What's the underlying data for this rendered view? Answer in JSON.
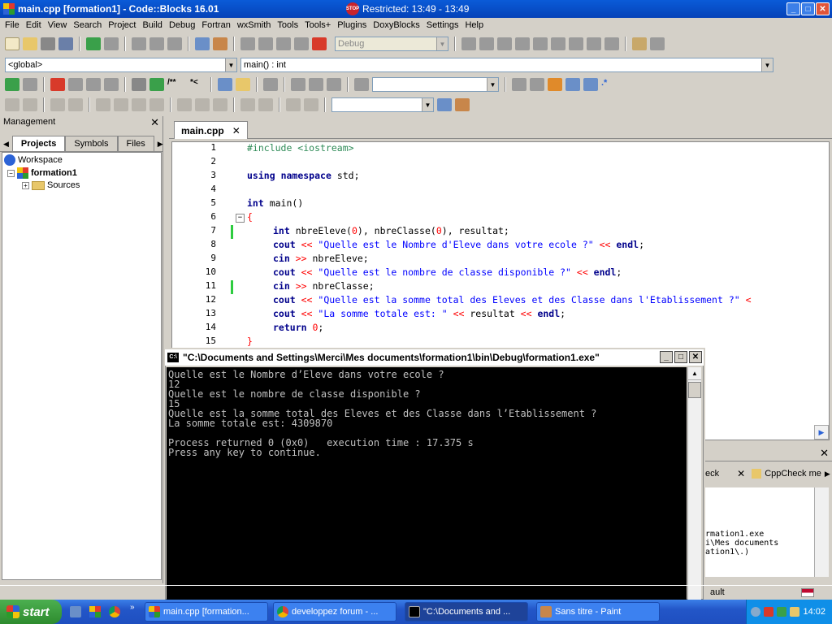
{
  "window": {
    "title": "main.cpp [formation1] - Code::Blocks 16.01",
    "restricted": "Restricted: 13:49 - 13:49",
    "stop_label": "STOP"
  },
  "menu": [
    "File",
    "Edit",
    "View",
    "Search",
    "Project",
    "Build",
    "Debug",
    "Fortran",
    "wxSmith",
    "Tools",
    "Tools+",
    "Plugins",
    "DoxyBlocks",
    "Settings",
    "Help"
  ],
  "toolbar": {
    "build_target": "Debug"
  },
  "scope": {
    "global": "<global>",
    "symbol": "main() : int"
  },
  "management": {
    "title": "Management",
    "tabs": [
      "Projects",
      "Symbols",
      "Files"
    ],
    "tree": {
      "workspace": "Workspace",
      "project": "formation1",
      "folder": "Sources"
    }
  },
  "editor": {
    "tab": "main.cpp",
    "lines": [
      "1",
      "2",
      "3",
      "4",
      "5",
      "6",
      "7",
      "8",
      "9",
      "10",
      "11",
      "12",
      "13",
      "14",
      "15"
    ]
  },
  "code": {
    "l1": "#include <iostream>",
    "l3_kw1": "using",
    "l3_kw2": "namespace",
    "l3_rest": "std;",
    "l5_kw": "int",
    "l5_rest": " main()",
    "l6": "{",
    "l7_kw": "int",
    "l7_a": " nbreEleve(",
    "l7_n1": "0",
    "l7_b": "), nbreClasse(",
    "l7_n2": "0",
    "l7_c": "), resultat;",
    "l8_kw": "cout",
    "l8_op": " << ",
    "l8_str": "\"Quelle est le Nombre d'Eleve dans votre ecole ?\"",
    "l8_op2": " << ",
    "l8_end": "endl",
    "l8_semi": ";",
    "l9_kw": "cin",
    "l9_op": " >> ",
    "l9_rest": "nbreEleve;",
    "l10_kw": "cout",
    "l10_op": " << ",
    "l10_str": "\"Quelle est le nombre de classe disponible ?\"",
    "l10_op2": " << ",
    "l10_end": "endl",
    "l10_semi": ";",
    "l11_kw": "cin",
    "l11_op": " >> ",
    "l11_rest": "nbreClasse;",
    "l12_kw": "cout",
    "l12_op": " << ",
    "l12_str": "\"Quelle est la somme total des Eleves et des Classe dans l'Etablissement ?\"",
    "l12_op2": " <",
    "l13_kw": "cout",
    "l13_op": " << ",
    "l13_str": "\"La somme totale est: \"",
    "l13_op2": " << ",
    "l13_mid": "resultat",
    "l13_op3": " << ",
    "l13_end": "endl",
    "l13_semi": ";",
    "l14_kw": "return",
    "l14_n": " 0",
    "l14_semi": ";",
    "l15": "}"
  },
  "console": {
    "title": "\"C:\\Documents and Settings\\Merci\\Mes documents\\formation1\\bin\\Debug\\formation1.exe\"",
    "icon": "C:\\",
    "output": "Quelle est le Nombre d’Eleve dans votre ecole ?\n12\nQuelle est le nombre de classe disponible ?\n15\nQuelle est la somme total des Eleves et des Classe dans l’Etablissement ?\nLa somme totale est: 4309870\n\nProcess returned 0 (0x0)   execution time : 17.375 s\nPress any key to continue."
  },
  "logs": {
    "tab1": "eck",
    "tab2": "CppCheck me",
    "body": "rmation1.exe\ni\\Mes documents\nation1\\.)"
  },
  "status": {
    "right": "ault"
  },
  "taskbar": {
    "start": "start",
    "buttons": [
      "main.cpp [formation...",
      "developpez forum - ...",
      "\"C:\\Documents and ...",
      "Sans titre - Paint"
    ],
    "clock": "14:02"
  },
  "colors": {
    "title_bar": "#0542b8",
    "taskbar": "#2356c8",
    "start": "#2e8b2e"
  }
}
